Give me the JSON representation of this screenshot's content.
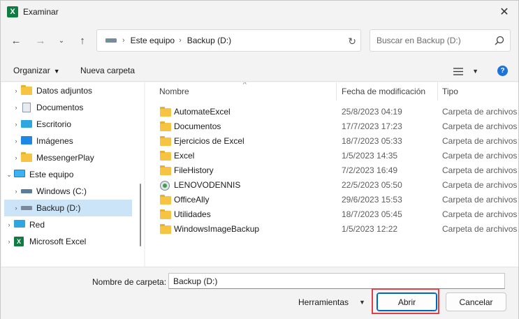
{
  "window": {
    "title": "Examinar",
    "app_icon": "excel-icon"
  },
  "nav_buttons": {
    "back": "back-arrow-icon",
    "forward": "forward-arrow-icon",
    "recent": "chevron-down-icon",
    "up": "up-arrow-icon"
  },
  "address": {
    "crumbs": [
      "Este equipo",
      "Backup (D:)"
    ]
  },
  "search": {
    "placeholder": "Buscar en Backup (D:)"
  },
  "commandbar": {
    "organize": "Organizar",
    "new_folder": "Nueva carpeta"
  },
  "navpane": {
    "items": [
      {
        "label": "Datos adjuntos",
        "icon": "folder-icon",
        "expandable": true
      },
      {
        "label": "Documentos",
        "icon": "documents-icon",
        "expandable": true
      },
      {
        "label": "Escritorio",
        "icon": "desktop-icon",
        "expandable": true
      },
      {
        "label": "Imágenes",
        "icon": "pictures-icon",
        "expandable": true
      },
      {
        "label": "MessengerPlay",
        "icon": "folder-icon",
        "expandable": true
      },
      {
        "label": "Este equipo",
        "icon": "this-pc-icon",
        "expandable": true,
        "expanded": true
      },
      {
        "label": "Windows (C:)",
        "icon": "windows-drive-icon",
        "expandable": true
      },
      {
        "label": "Backup (D:)",
        "icon": "drive-icon",
        "expandable": true,
        "selected": true
      },
      {
        "label": "Red",
        "icon": "network-icon",
        "expandable": true
      },
      {
        "label": "Microsoft Excel",
        "icon": "excel-icon",
        "expandable": true
      }
    ]
  },
  "filelist": {
    "columns": {
      "name": "Nombre",
      "date": "Fecha de modificación",
      "type": "Tipo"
    },
    "rows": [
      {
        "name": "AutomateExcel",
        "date": "25/8/2023 04:19",
        "type": "Carpeta de archivos",
        "icon": "folder-icon"
      },
      {
        "name": "Documentos",
        "date": "17/7/2023 17:23",
        "type": "Carpeta de archivos",
        "icon": "folder-icon"
      },
      {
        "name": "Ejercicios de Excel",
        "date": "18/7/2023 05:33",
        "type": "Carpeta de archivos",
        "icon": "folder-icon"
      },
      {
        "name": "Excel",
        "date": "1/5/2023 14:35",
        "type": "Carpeta de archivos",
        "icon": "folder-icon"
      },
      {
        "name": "FileHistory",
        "date": "7/2/2023 16:49",
        "type": "Carpeta de archivos",
        "icon": "folder-icon"
      },
      {
        "name": "LENOVODENNIS",
        "date": "22/5/2023 05:50",
        "type": "Carpeta de archivos",
        "icon": "lenovo-folder-icon"
      },
      {
        "name": "OfficeAlly",
        "date": "29/6/2023 15:53",
        "type": "Carpeta de archivos",
        "icon": "folder-icon"
      },
      {
        "name": "Utilidades",
        "date": "18/7/2023 05:45",
        "type": "Carpeta de archivos",
        "icon": "folder-icon"
      },
      {
        "name": "WindowsImageBackup",
        "date": "1/5/2023 12:22",
        "type": "Carpeta de archivos",
        "icon": "folder-icon"
      }
    ]
  },
  "footer": {
    "folder_label": "Nombre de carpeta:",
    "folder_value": "Backup (D:)",
    "tools": "Herramientas",
    "open": "Abrir",
    "cancel": "Cancelar"
  },
  "colors": {
    "selection": "#cce4f7",
    "highlight_box": "#e0404a",
    "primary_border": "#0067c0"
  }
}
